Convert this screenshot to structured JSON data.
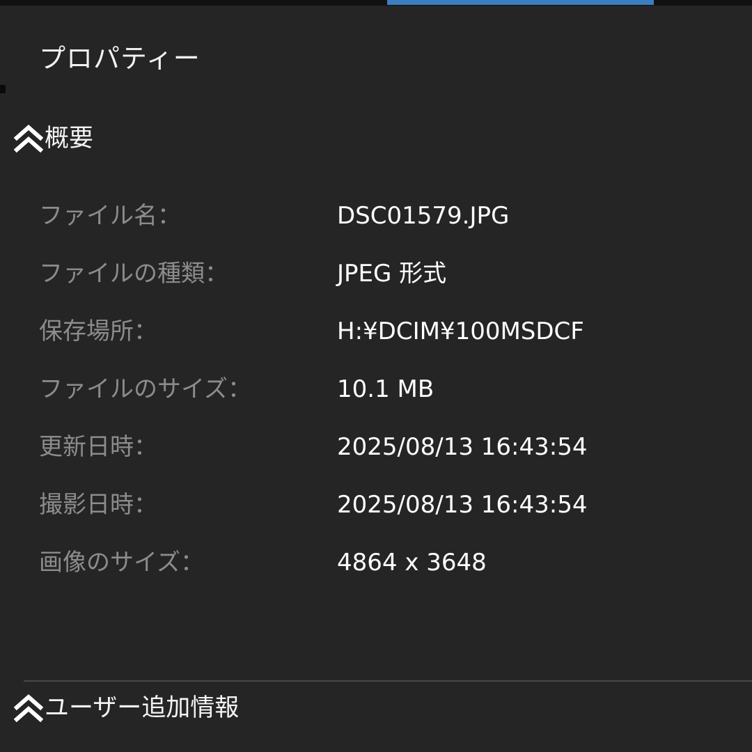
{
  "panel": {
    "title": "プロパティー"
  },
  "sections": {
    "summary": {
      "label": "概要",
      "icon": "double-chevron-up-icon"
    },
    "user_info": {
      "label": "ユーザー追加情報",
      "icon": "double-chevron-up-icon"
    }
  },
  "properties": [
    {
      "label": "ファイル名：",
      "value": "DSC01579.JPG"
    },
    {
      "label": "ファイルの種類：",
      "value": "JPEG 形式"
    },
    {
      "label": "保存場所：",
      "value": "H:¥DCIM¥100MSDCF"
    },
    {
      "label": "ファイルのサイズ：",
      "value": "10.1 MB"
    },
    {
      "label": "更新日時：",
      "value": "2025/08/13 16:43:54"
    },
    {
      "label": "撮影日時：",
      "value": "2025/08/13 16:43:54"
    },
    {
      "label": "画像のサイズ：",
      "value": "4864 x 3648"
    }
  ],
  "colors": {
    "background": "#252525",
    "accent": "#3c7fc0",
    "label_text": "#8c8c8c",
    "value_text": "#ffffff"
  }
}
